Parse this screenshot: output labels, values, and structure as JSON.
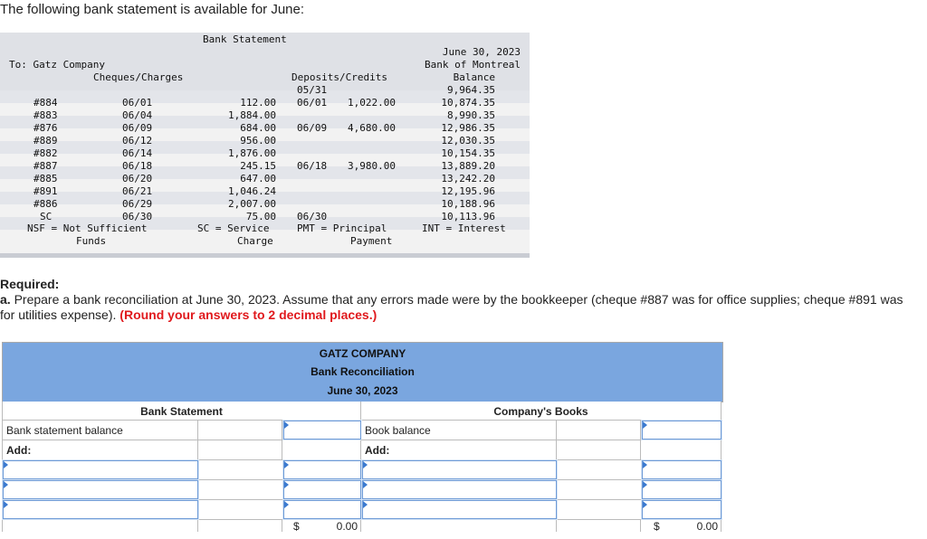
{
  "intro": "The following bank statement is available for June:",
  "statement": {
    "title": "Bank Statement",
    "to": "To: Gatz Company",
    "date": "June 30, 2023",
    "bank": "Bank of Montreal",
    "col_cheques": "Cheques/Charges",
    "col_deposits": "Deposits/Credits",
    "col_balance": "Balance",
    "opening_date": "05/31",
    "opening_balance": "9,964.35",
    "rows": [
      {
        "no": "#884",
        "date": "06/01",
        "amount": "112.00",
        "dep_date": "06/01",
        "dep_amt": "1,022.00",
        "balance": "10,874.35"
      },
      {
        "no": "#883",
        "date": "06/04",
        "amount": "1,884.00",
        "dep_date": "",
        "dep_amt": "",
        "balance": "8,990.35"
      },
      {
        "no": "#876",
        "date": "06/09",
        "amount": "684.00",
        "dep_date": "06/09",
        "dep_amt": "4,680.00",
        "balance": "12,986.35"
      },
      {
        "no": "#889",
        "date": "06/12",
        "amount": "956.00",
        "dep_date": "",
        "dep_amt": "",
        "balance": "12,030.35"
      },
      {
        "no": "#882",
        "date": "06/14",
        "amount": "1,876.00",
        "dep_date": "",
        "dep_amt": "",
        "balance": "10,154.35"
      },
      {
        "no": "#887",
        "date": "06/18",
        "amount": "245.15",
        "dep_date": "06/18",
        "dep_amt": "3,980.00",
        "balance": "13,889.20"
      },
      {
        "no": "#885",
        "date": "06/20",
        "amount": "647.00",
        "dep_date": "",
        "dep_amt": "",
        "balance": "13,242.20"
      },
      {
        "no": "#891",
        "date": "06/21",
        "amount": "1,046.24",
        "dep_date": "",
        "dep_amt": "",
        "balance": "12,195.96"
      },
      {
        "no": "#886",
        "date": "06/29",
        "amount": "2,007.00",
        "dep_date": "",
        "dep_amt": "",
        "balance": "10,188.96"
      },
      {
        "no": "SC",
        "date": "06/30",
        "amount": "75.00",
        "dep_date": "06/30",
        "dep_amt": "",
        "balance": "10,113.96"
      }
    ],
    "legend": {
      "nsf_1": "NSF = Not Sufficient",
      "nsf_2": "Funds",
      "sc_1": "SC = Service",
      "sc_2": "Charge",
      "pmt_1": "PMT = Principal",
      "pmt_2": "Payment",
      "int_1": "INT = Interest"
    }
  },
  "required": {
    "heading": "Required:",
    "part_label": "a.",
    "text": " Prepare a bank reconciliation at June 30, 2023. Assume that any errors made were by the bookkeeper (cheque #887 was for office supplies; cheque #891 was for utilities expense). ",
    "instruction": "(Round your answers to 2 decimal places.)"
  },
  "reconciliation": {
    "company": "GATZ COMPANY",
    "title": "Bank Reconciliation",
    "date": "June 30, 2023",
    "bank_header": "Bank Statement",
    "books_header": "Company's Books",
    "bank_balance_label": "Bank statement balance",
    "book_balance_label": "Book balance",
    "add_label_left": "Add:",
    "add_label_right": "Add:",
    "currency": "$",
    "left_total": "0.00",
    "right_total": "0.00"
  },
  "colors": {
    "header_blue": "#7aa6df",
    "instruction_red": "#e0191d",
    "input_border": "#6d9ad6"
  }
}
